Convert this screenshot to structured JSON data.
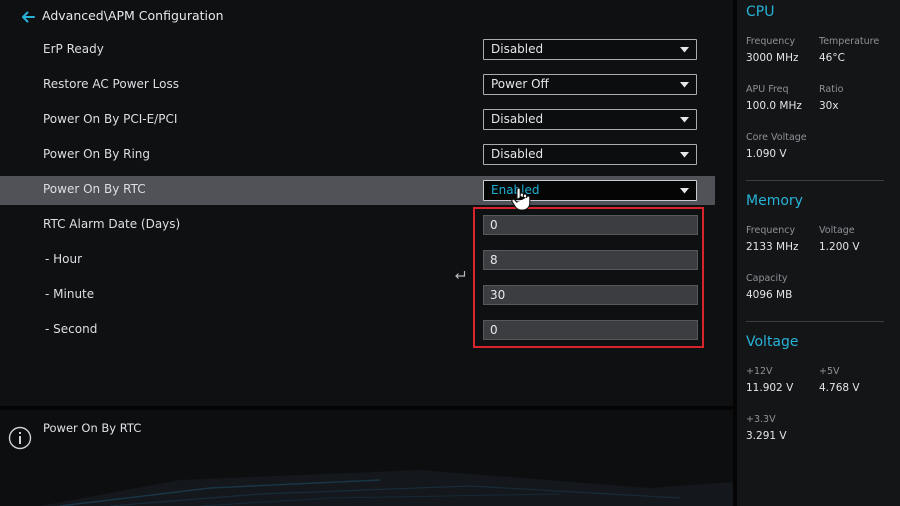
{
  "header": {
    "title": "Advanced\\APM Configuration"
  },
  "settings": [
    {
      "label": "ErP Ready",
      "value": "Disabled"
    },
    {
      "label": "Restore AC Power Loss",
      "value": "Power Off"
    },
    {
      "label": "Power On By PCI-E/PCI",
      "value": "Disabled"
    },
    {
      "label": "Power On By Ring",
      "value": "Disabled"
    },
    {
      "label": "Power On By RTC",
      "value": "Enabled"
    }
  ],
  "rtc_fields": [
    {
      "label": "RTC Alarm Date (Days)",
      "value": "0"
    },
    {
      "label": "- Hour",
      "value": "8"
    },
    {
      "label": "- Minute",
      "value": "30"
    },
    {
      "label": "- Second",
      "value": "0"
    }
  ],
  "help": {
    "text": "Power On By RTC"
  },
  "hardware_monitor": {
    "cpu": {
      "title": "CPU",
      "frequency_label": "Frequency",
      "frequency_value": "3000 MHz",
      "temperature_label": "Temperature",
      "temperature_value": "46°C",
      "apu_freq_label": "APU Freq",
      "apu_freq_value": "100.0 MHz",
      "ratio_label": "Ratio",
      "ratio_value": "30x",
      "core_voltage_label": "Core Voltage",
      "core_voltage_value": "1.090 V"
    },
    "memory": {
      "title": "Memory",
      "frequency_label": "Frequency",
      "frequency_value": "2133 MHz",
      "voltage_label": "Voltage",
      "voltage_value": "1.200 V",
      "capacity_label": "Capacity",
      "capacity_value": "4096 MB"
    },
    "voltage": {
      "title": "Voltage",
      "v12_label": "+12V",
      "v12_value": "11.902 V",
      "v5_label": "+5V",
      "v5_value": "4.768 V",
      "v33_label": "+3.3V",
      "v33_value": "3.291 V"
    }
  },
  "colors": {
    "accent": "#27b3d8",
    "highlight_row": "#505257",
    "annotation_box": "#d8242a"
  },
  "icons": {
    "back": "back-arrow-icon",
    "dropdown": "chevron-down-icon",
    "info": "info-icon",
    "cursor": "hand-cursor-icon",
    "enter": "enter-key-icon"
  }
}
